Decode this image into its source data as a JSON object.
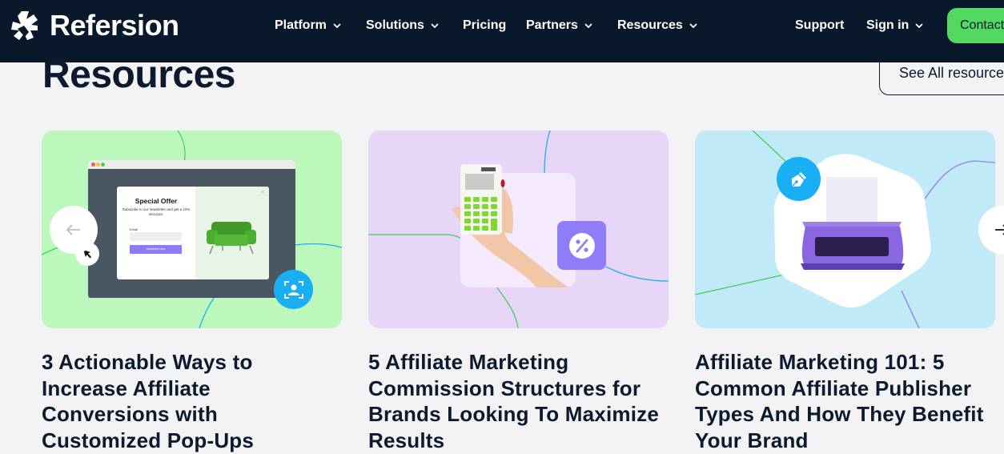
{
  "brand": {
    "name": "Refersion",
    "colors": {
      "nav_bg": "#09192b",
      "accent_green": "#53d962",
      "text_dark": "#0b1a2e",
      "page_bg": "#f3f3f6"
    }
  },
  "nav": {
    "items": [
      {
        "label": "Platform",
        "has_dropdown": true
      },
      {
        "label": "Solutions",
        "has_dropdown": true
      },
      {
        "label": "Pricing",
        "has_dropdown": false
      },
      {
        "label": "Partners",
        "has_dropdown": true
      },
      {
        "label": "Resources",
        "has_dropdown": true
      }
    ],
    "support_label": "Support",
    "signin_label": "Sign in",
    "contact_label": "Contact"
  },
  "section": {
    "title": "Resources",
    "see_all_label": "See All resources"
  },
  "carousel": {
    "prev_icon": "arrow-left-icon",
    "next_icon": "arrow-right-icon",
    "cards": [
      {
        "title": "3 Actionable Ways to Increase Affiliate Conversions with Customized Pop-Ups",
        "bg_color": "#bcf8bb",
        "badge_icon": "user-focus-icon",
        "badge_color": "#1aaff5",
        "popup": {
          "title": "Special Offer",
          "description": "Subscribe to our newsletter and get a 10% discount.",
          "field_label": "Email",
          "button_label": "Subscribe Now"
        }
      },
      {
        "title": "5 Affiliate Marketing Commission Structures for Brands Looking To Maximize Results",
        "bg_color": "#e7d6f8",
        "badge_icon": "percent-icon",
        "badge_color": "#8f7cf8"
      },
      {
        "title": "Affiliate Marketing 101: 5 Common Affiliate Publisher Types And How They Benefit Your Brand",
        "bg_color": "#c0eaf8",
        "badge_icon": "pen-nib-icon",
        "badge_color": "#1aaff5"
      }
    ]
  }
}
